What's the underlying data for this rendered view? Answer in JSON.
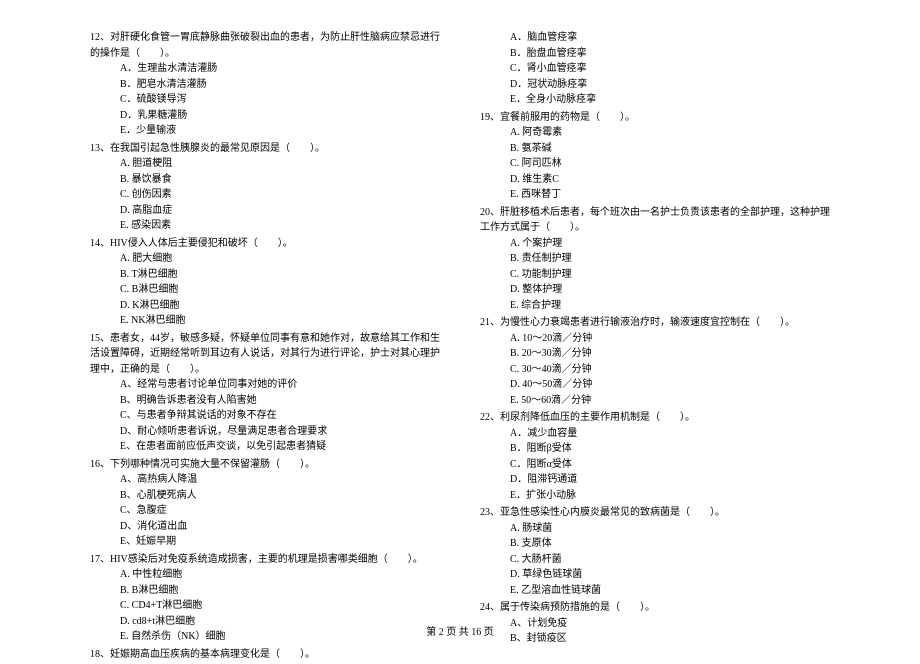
{
  "left": {
    "q12": {
      "text": "12、对肝硬化食管一胃底静脉曲张破裂出血的患者，为防止肝性脑病应禁忌进行的操作是（　　）。",
      "opts": [
        "A．生理盐水清洁灌肠",
        "B．肥皂水清洁灌肠",
        "C．硫酸镁导泻",
        "D．乳果糖灌肠",
        "E．少量输液"
      ]
    },
    "q13": {
      "text": "13、在我国引起急性胰腺炎的最常见原因是（　　）。",
      "opts": [
        "A. 胆道梗阻",
        "B. 暴饮暴食",
        "C. 创伤因素",
        "D. 高脂血症",
        "E. 感染因素"
      ]
    },
    "q14": {
      "text": "14、HIV侵入人体后主要侵犯和破坏（　　）。",
      "opts": [
        "A. 肥大细胞",
        "B. T淋巴细胞",
        "C. B淋巴细胞",
        "D. K淋巴细胞",
        "E. NK淋巴细胞"
      ]
    },
    "q15": {
      "text": "15、患者女，44岁，敏感多疑，怀疑单位同事有意和她作对，故意给其工作和生活设置障碍，近期经常听到耳边有人说话，对其行为进行评论，护士对其心理护理中，正确的是（　　）。",
      "opts": [
        "A、经常与患者讨论单位同事对她的评价",
        "B、明确告诉患者没有人陷害她",
        "C、与患者争辩其说话的对象不存在",
        "D、耐心倾听患者诉说，尽量满足患者合理要求",
        "E、在患者面前应低声交谈，以免引起患者猜疑"
      ]
    },
    "q16": {
      "text": "16、下列哪种情况可实施大量不保留灌肠（　　）。",
      "opts": [
        "A、高热病人降温",
        "B、心肌梗死病人",
        "C、急腹症",
        "D、消化道出血",
        "E、妊娠早期"
      ]
    },
    "q17": {
      "text": "17、HIV感染后对免疫系统造成损害，主要的机理是损害哪类细胞（　　）。",
      "opts": [
        "A. 中性粒细胞",
        "B. B淋巴细胞",
        "C. CD4+T淋巴细胞",
        "D. cd8+t淋巴细胞",
        "E. 自然杀伤（NK）细胞"
      ]
    },
    "q18": {
      "text": "18、妊娠期高血压疾病的基本病理变化是（　　）。"
    }
  },
  "right": {
    "q18opts": [
      "A．脑血管痉挛",
      "B．胎盘血管痉挛",
      "C．肾小血管痉挛",
      "D．冠状动脉痉挛",
      "E．全身小动脉痉挛"
    ],
    "q19": {
      "text": "19、宜餐前服用的药物是（　　）。",
      "opts": [
        "A. 阿奇霉素",
        "B. 氨茶碱",
        "C. 阿司匹林",
        "D. 维生素C",
        "E. 西咪替丁"
      ]
    },
    "q20": {
      "text": "20、肝脏移植术后患者，每个班次由一名护士负责该患者的全部护理，这种护理工作方式属于（　　）。",
      "opts": [
        "A. 个案护理",
        "B. 责任制护理",
        "C. 功能制护理",
        "D. 整体护理",
        "E. 综合护理"
      ]
    },
    "q21": {
      "text": "21、为慢性心力衰竭患者进行输液治疗时，输液速度宜控制在（　　）。",
      "opts": [
        "A. 10～20滴／分钟",
        "B. 20～30滴／分钟",
        "C. 30～40滴／分钟",
        "D. 40～50滴／分钟",
        "E. 50～60滴／分钟"
      ]
    },
    "q22": {
      "text": "22、利尿剂降低血压的主要作用机制是（　　）。",
      "opts": [
        "A．减少血容量",
        "B．阻断β受体",
        "C．阻断α受体",
        "D．阻滞钙通道",
        "E．扩张小动脉"
      ]
    },
    "q23": {
      "text": "23、亚急性感染性心内膜炎最常见的致病菌是（　　）。",
      "opts": [
        "A. 肠球菌",
        "B. 支原体",
        "C. 大肠杆菌",
        "D. 草绿色链球菌",
        "E. 乙型溶血性链球菌"
      ]
    },
    "q24": {
      "text": "24、属于传染病预防措施的是（　　）。",
      "opts": [
        "A、计划免疫",
        "B、封锁疫区"
      ]
    }
  },
  "footer": "第 2 页 共 16 页"
}
